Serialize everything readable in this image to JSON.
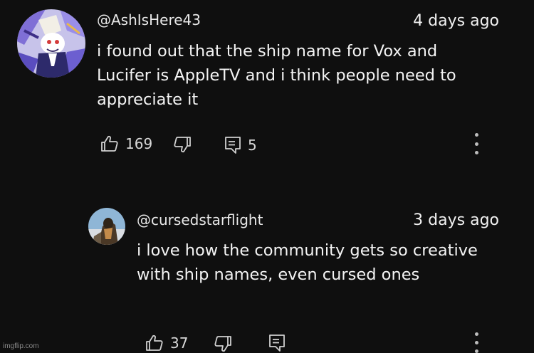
{
  "comments": [
    {
      "username": "@AshIsHere43",
      "timestamp": "4 days ago",
      "text": "i found out that the ship name for Vox and Lucifer is AppleTV and i think people need to appreciate it",
      "likes": "169",
      "replies": "5",
      "avatar_icon": "cartoon-character-avatar"
    },
    {
      "username": "@cursedstarflight",
      "timestamp": "3 days ago",
      "text": "i love how the community gets so creative with ship names, even cursed ones",
      "likes": "37",
      "replies": "",
      "avatar_icon": "photo-avatar"
    }
  ],
  "icons": {
    "like": "thumbs-up-icon",
    "dislike": "thumbs-down-icon",
    "reply": "reply-icon",
    "more": "more-vertical-icon"
  },
  "colors": {
    "background": "#0f0f0f",
    "text": "#f1f1f1",
    "icon": "#d0d0d0"
  },
  "watermark": "imgflip.com"
}
